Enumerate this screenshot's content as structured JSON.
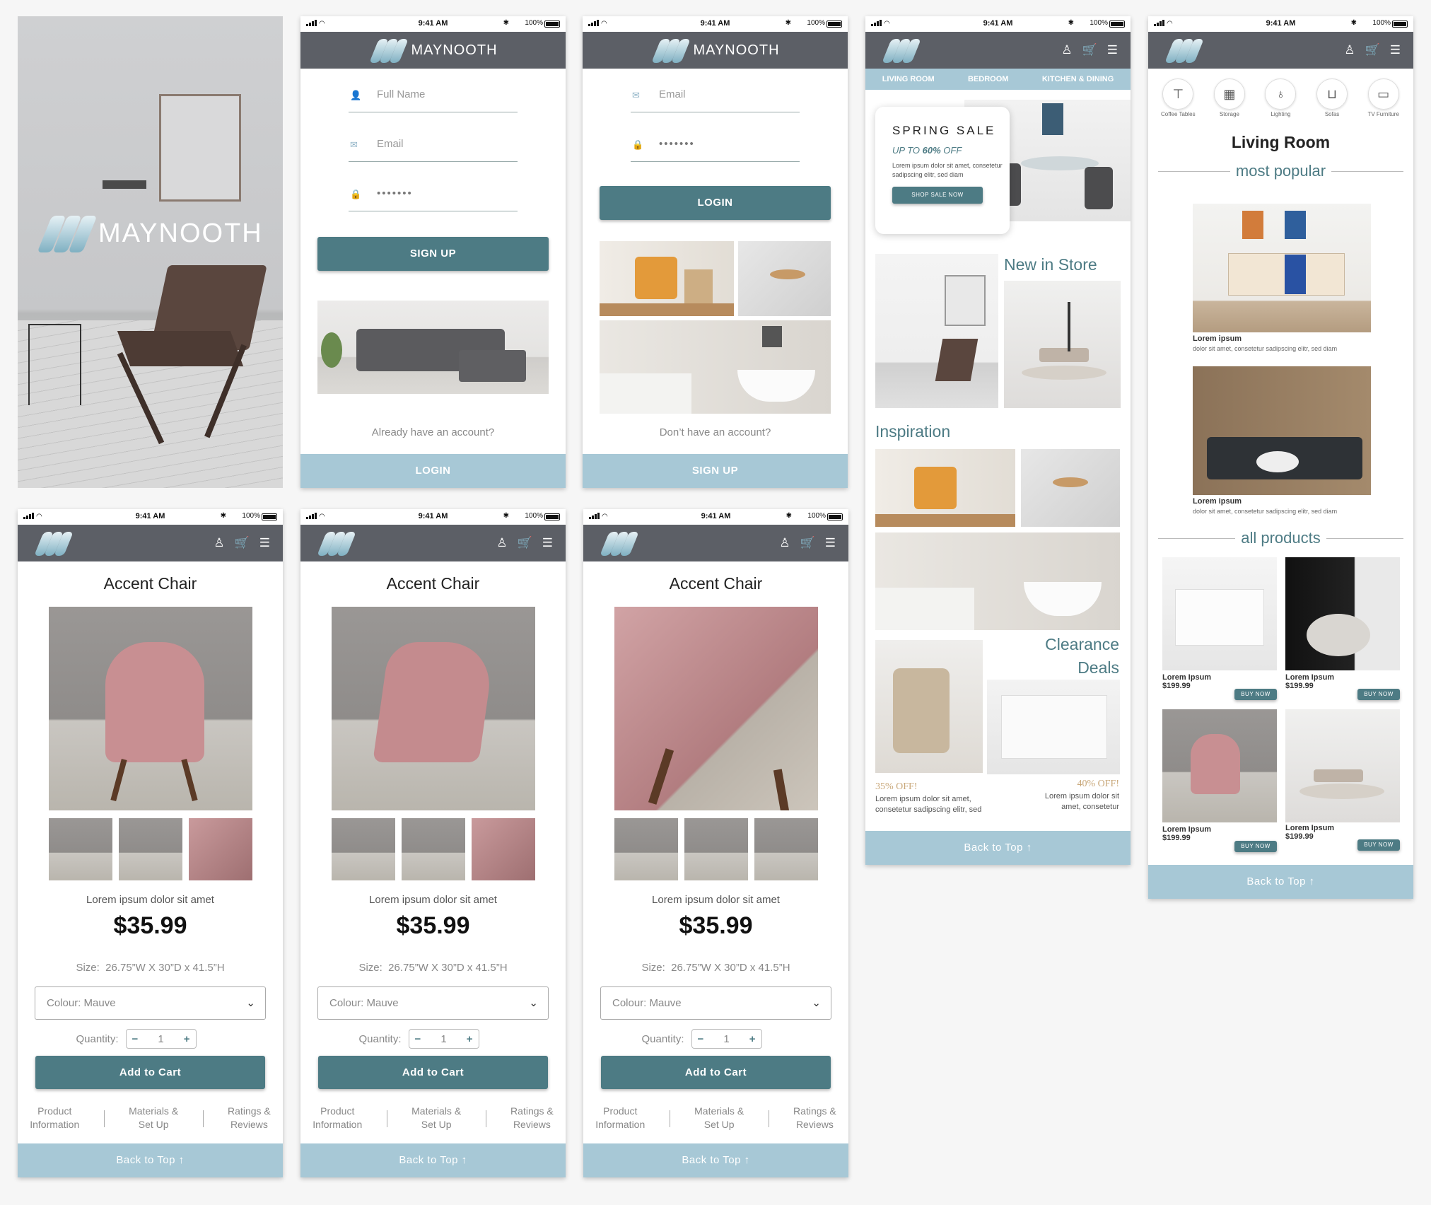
{
  "brand": {
    "name": "MAYNOOTH",
    "accent": "#4d7b84",
    "footer": "#a7c8d6",
    "header": "#5c5f66"
  },
  "status": {
    "time": "9:41 AM",
    "battery": "100%"
  },
  "signup": {
    "fields": [
      {
        "icon": "user-icon",
        "placeholder": "Full Name"
      },
      {
        "icon": "email-icon",
        "placeholder": "Email"
      },
      {
        "icon": "lock-icon",
        "value": "•••••••"
      }
    ],
    "button": "SIGN UP",
    "prompt": "Already have an account?",
    "footer": "LOGIN"
  },
  "login": {
    "fields": [
      {
        "icon": "email-icon",
        "placeholder": "Email"
      },
      {
        "icon": "lock-icon",
        "value": "•••••••"
      }
    ],
    "button": "LOGIN",
    "prompt": "Don’t have an account?",
    "footer": "SIGN UP"
  },
  "home": {
    "nav": [
      "LIVING ROOM",
      "BEDROOM",
      "KITCHEN & DINING"
    ],
    "sale": {
      "title": "SPRING SALE",
      "sub_pre": "UP TO ",
      "sub_pct": "60%",
      "sub_post": " OFF",
      "body": "Lorem ipsum dolor sit amet, consetetur sadipscing elitr, sed diam",
      "cta": "SHOP SALE NOW"
    },
    "new_in_store": "New in Store",
    "inspiration": "Inspiration",
    "clearance": [
      "Clearance",
      "Deals"
    ],
    "deal_left": {
      "pct": "35% OFF!",
      "text": "Lorem ipsum dolor sit amet, consetetur sadipscing elitr, sed"
    },
    "deal_right": {
      "pct": "40% OFF!",
      "text": "Lorem ipsum dolor sit amet, consetetur"
    },
    "footer": "Back to Top"
  },
  "category": {
    "icons": [
      {
        "icon": "coffee-table-icon",
        "label": "Coffee Tables"
      },
      {
        "icon": "storage-icon",
        "label": "Storage"
      },
      {
        "icon": "lighting-icon",
        "label": "Lighting"
      },
      {
        "icon": "sofa-icon",
        "label": "Sofas"
      },
      {
        "icon": "tv-furniture-icon",
        "label": "TV Furniture"
      }
    ],
    "title": "Living Room",
    "most_popular": "most popular",
    "popular": [
      {
        "title": "Lorem ipsum",
        "desc": "dolor sit amet, consetetur sadipscing elitr, sed diam"
      },
      {
        "title": "Lorem ipsum",
        "desc": "dolor sit amet, consetetur sadipscing elitr, sed diam"
      }
    ],
    "all_products": "all products",
    "products": [
      {
        "name": "Lorem Ipsum",
        "price": "$199.99",
        "cta": "BUY NOW"
      },
      {
        "name": "Lorem Ipsum",
        "price": "$199.99",
        "cta": "BUY NOW"
      },
      {
        "name": "Lorem Ipsum",
        "price": "$199.99",
        "cta": "BUY NOW"
      },
      {
        "name": "Lorem Ipsum",
        "price": "$199.99",
        "cta": "BUY NOW"
      }
    ],
    "footer": "Back to Top"
  },
  "product": {
    "title": "Accent Chair",
    "desc": "Lorem ipsum dolor sit amet",
    "price": "$35.99",
    "size_label": "Size:",
    "size": "26.75”W X 30”D x 41.5”H",
    "colour": "Colour: Mauve",
    "qty_label": "Quantity:",
    "qty": "1",
    "minus": "−",
    "plus": "+",
    "add": "Add to Cart",
    "tabs": [
      [
        "Product",
        "Information"
      ],
      [
        "Materials &",
        "Set Up"
      ],
      [
        "Ratings &",
        "Reviews"
      ]
    ],
    "footer": "Back to Top"
  }
}
